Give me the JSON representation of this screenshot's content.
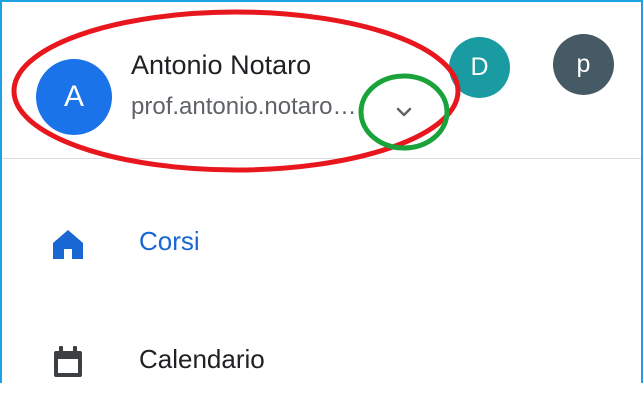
{
  "account": {
    "name": "Antonio Notaro",
    "email": "prof.antonio.notaro@...",
    "avatar_letter": "A",
    "avatar_color": "#1a73e8"
  },
  "other_accounts": [
    {
      "letter": "D",
      "color": "#1a9ba1"
    },
    {
      "letter": "p",
      "color": "#455a64"
    }
  ],
  "dropdown_icon": "chevron-down-icon",
  "nav": {
    "items": [
      {
        "label": "Corsi",
        "icon": "home-icon",
        "selected": true,
        "color": "#1967d2"
      },
      {
        "label": "Calendario",
        "icon": "calendar-icon",
        "selected": false,
        "color": "#202124"
      }
    ]
  },
  "annotations": {
    "red_ellipse_color": "#e8171e",
    "green_ellipse_color": "#1aa33a"
  }
}
